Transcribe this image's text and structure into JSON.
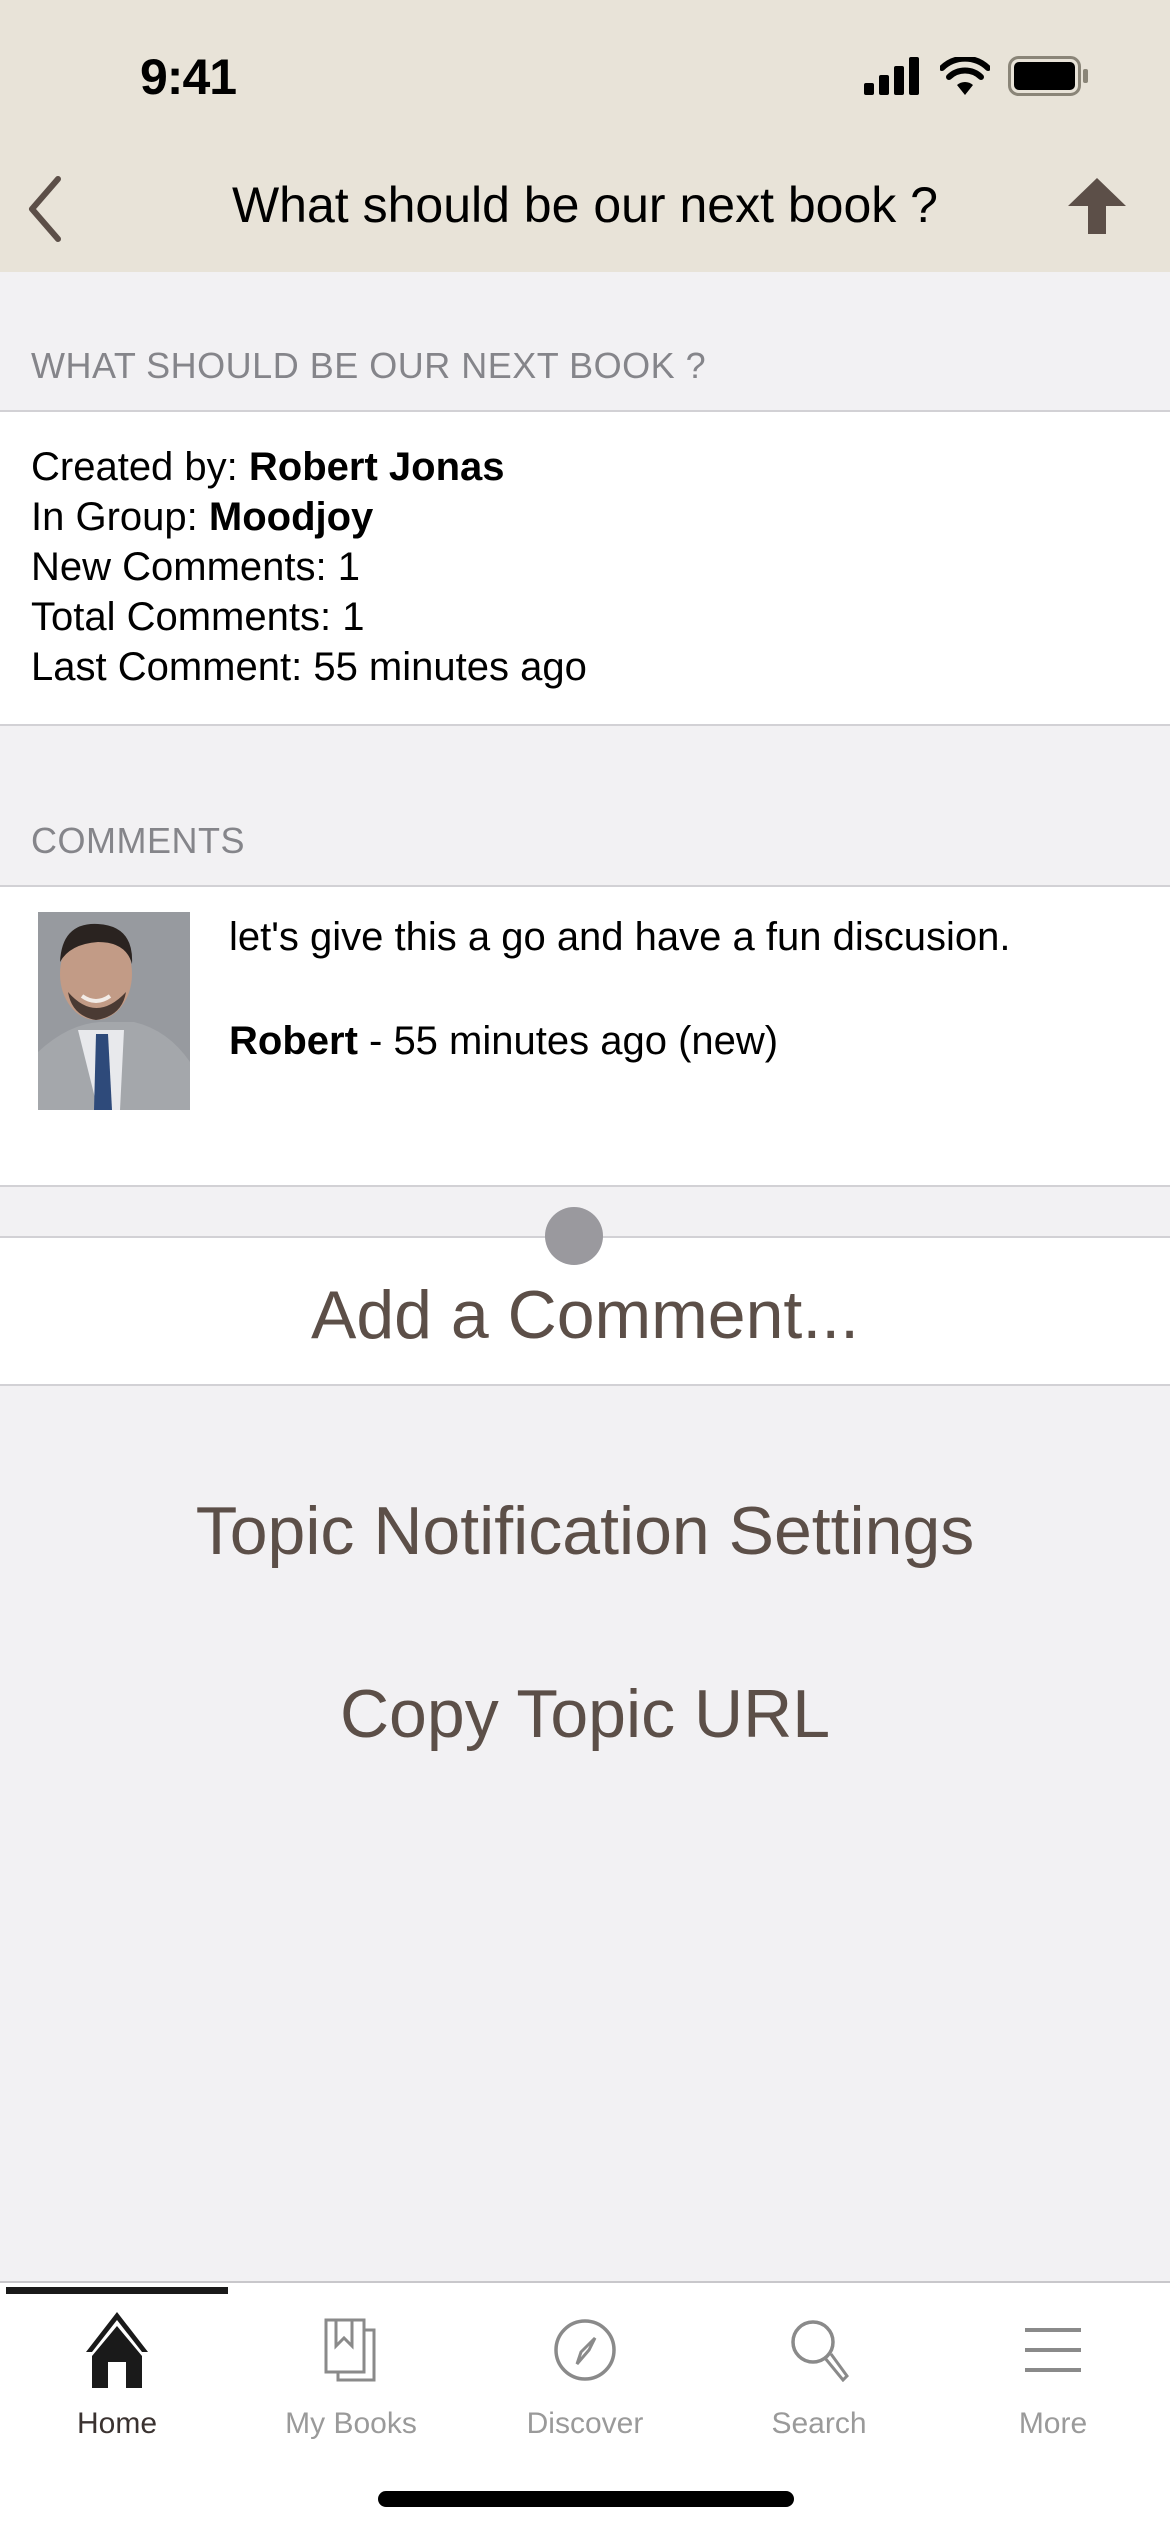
{
  "status_bar": {
    "time": "9:41",
    "icons": [
      "signal-icon",
      "wifi-icon",
      "battery-icon"
    ]
  },
  "nav": {
    "title": "What should be our next book ?",
    "back_icon": "chevron-left-icon",
    "right_icon": "arrow-up-icon"
  },
  "topic": {
    "section_header": "WHAT SHOULD BE OUR NEXT BOOK ?",
    "created_by_label": "Created by: ",
    "created_by_value": "Robert Jonas",
    "group_label": "In Group: ",
    "group_value": "Moodjoy",
    "new_comments_label": "New Comments: ",
    "new_comments_value": "1",
    "total_comments_label": "Total Comments: ",
    "total_comments_value": "1",
    "last_comment_label": "Last Comment: ",
    "last_comment_value": "55 minutes ago"
  },
  "comments": {
    "section_header": "COMMENTS",
    "items": [
      {
        "text": "let's give this a go and have a fun discusion.",
        "author": "Robert",
        "meta": " - 55 minutes ago (new)"
      }
    ]
  },
  "actions": {
    "add_comment": "Add a Comment...",
    "notification_settings": "Topic Notification Settings",
    "copy_url": "Copy Topic URL"
  },
  "tabbar": {
    "active": "Home",
    "tabs": [
      {
        "label": "Home",
        "icon": "home-icon"
      },
      {
        "label": "My Books",
        "icon": "books-icon"
      },
      {
        "label": "Discover",
        "icon": "compass-icon"
      },
      {
        "label": "Search",
        "icon": "search-icon"
      },
      {
        "label": "More",
        "icon": "menu-icon"
      }
    ]
  },
  "colors": {
    "header_bg": "#e8e3d8",
    "accent_brown": "#5c4f48",
    "page_bg": "#f2f1f3"
  }
}
